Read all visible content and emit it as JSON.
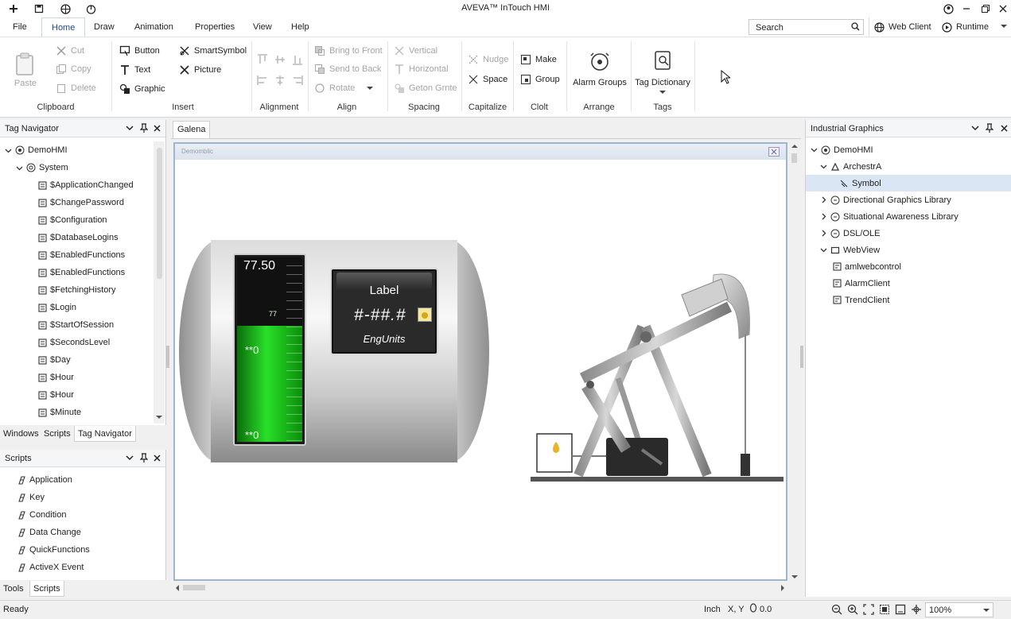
{
  "app": {
    "title": "AVEVA™ InTouch HMI"
  },
  "quick_access": [
    {
      "icon": "plus-icon"
    },
    {
      "icon": "save-icon"
    },
    {
      "icon": "globe-icon"
    },
    {
      "icon": "power-icon"
    }
  ],
  "window_controls": [
    {
      "icon": "account-icon"
    },
    {
      "icon": "minimize-icon"
    },
    {
      "icon": "restore-icon"
    },
    {
      "icon": "close-icon"
    }
  ],
  "menu": {
    "items": [
      "File",
      "Home",
      "Draw",
      "Animation",
      "Properties",
      "View",
      "Help"
    ],
    "active": "Home",
    "search_label": "Search",
    "web_client": "Web Client",
    "runtime": "Runtime"
  },
  "ribbon": {
    "clipboard": {
      "label": "Clipboard",
      "paste": "Paste",
      "cut": "Cut",
      "copy": "Copy",
      "delete": "Delete"
    },
    "insert": {
      "label": "Insert",
      "button": "Button",
      "text": "Text",
      "graphic": "Graphic",
      "smartsymbol": "SmartSymbol",
      "picture": "Picture"
    },
    "alignment": {
      "label": "Alignment"
    },
    "align": {
      "label": "Align",
      "bring_front": "Bring to Front",
      "send_back": "Send to Back",
      "rotate": "Rotate"
    },
    "spacing": {
      "label": "Spacing",
      "vertical": "Vertical",
      "horizontal": "Horizontal",
      "geton": "Geton Grnte"
    },
    "capitalize": {
      "label": "Capitalize",
      "nudge": "Nudge",
      "space": "Space"
    },
    "clolt": {
      "label": "Clolt",
      "make": "Make",
      "group": "Group"
    },
    "arrange": {
      "label": "Arrange",
      "alarm_groups": "Alarm Groups"
    },
    "tags": {
      "label": "Tags",
      "tag_dictionary": "Tag Dictionary"
    }
  },
  "tag_navigator": {
    "title": "Tag Navigator",
    "root": "DemoHMI",
    "system": "System",
    "items": [
      "$ApplicationChanged",
      "$ChangePassword",
      "$Configuration",
      "$DatabaseLogins",
      "$EnabledFunctions",
      "$EnabledFunctions",
      "$FetchingHistory",
      "$Login",
      "$StartOfSession",
      "$SecondsLevel",
      "$Day",
      "$Hour",
      "$Hour",
      "$Minute"
    ],
    "tabs": [
      "Windows",
      "Scripts",
      "Tag Navigator"
    ],
    "active_tab": "Tag Navigator"
  },
  "scripts": {
    "title": "Scripts",
    "items": [
      "Application",
      "Key",
      "Condition",
      "Data Change",
      "QuickFunctions",
      "ActiveX Event"
    ],
    "tabs": [
      "Tools",
      "Scripts"
    ],
    "active_tab": "Scripts"
  },
  "document": {
    "tab": "Galena",
    "window_caption": "Demomblic",
    "tank": {
      "value": "77.50",
      "level_fraction": 0.63,
      "scale_mark_top": "77",
      "scale_mark_mid": "**0",
      "scale_mark_bot": "**0"
    },
    "display": {
      "label": "Label",
      "value": "#-##.#",
      "units": "EngUnits"
    }
  },
  "industrial_graphics": {
    "title": "Industrial Graphics",
    "root": "DemoHMI",
    "archestra": "ArchestrA",
    "symbol": "Symbol",
    "libraries": [
      "Directional Graphics Library",
      "Situational Awareness Library",
      "DSL/OLE"
    ],
    "webview": "WebView",
    "webview_items": [
      "amlwebcontrol",
      "AlarmClient",
      "TrendClient"
    ]
  },
  "status": {
    "text": "Ready",
    "units": "Inch",
    "coords_label": "X, Y",
    "coords_value": "0.0",
    "zoom": "100%"
  },
  "colors": {
    "accent": "#1a5fb4",
    "level": "#1ec41e",
    "selected": "#dbe6f4"
  }
}
